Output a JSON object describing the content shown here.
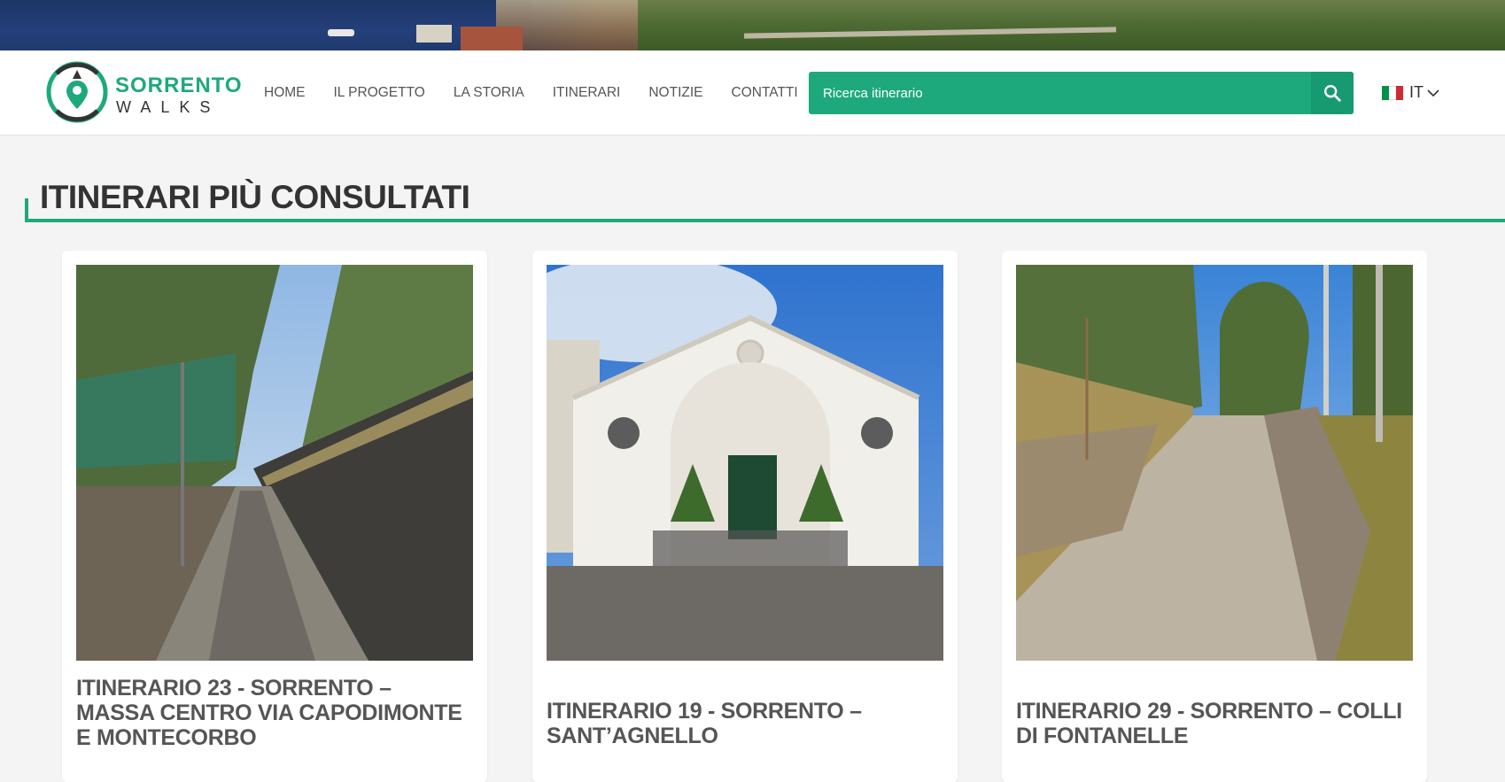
{
  "header": {
    "logo": {
      "word1": "SORRENTO",
      "word2": "WALKS",
      "icon": "compass-pin-icon"
    },
    "nav": [
      {
        "label": "HOME"
      },
      {
        "label": "IL PROGETTO"
      },
      {
        "label": "LA STORIA"
      },
      {
        "label": "ITINERARI"
      },
      {
        "label": "NOTIZIE"
      },
      {
        "label": "CONTATTI"
      }
    ],
    "search": {
      "placeholder": "Ricerca itinerario",
      "icon": "search-icon"
    },
    "language": {
      "code": "IT",
      "icon": "chevron-down-icon",
      "flag_colors": [
        "#009246",
        "#ffffff",
        "#ce2b37"
      ]
    }
  },
  "section": {
    "title": "ITINERARI PIÙ CONSULTATI"
  },
  "cards": [
    {
      "title": "ITINERARIO 23 - SORRENTO – MASSA CENTRO VIA CAPODIMONTE E MONTECORBO"
    },
    {
      "title": "ITINERARIO 19 - SORRENTO – SANT’AGNELLO"
    },
    {
      "title": "ITINERARIO 29 - SORRENTO – COLLI DI FONTANELLE"
    }
  ],
  "colors": {
    "accent": "#1ea97c",
    "accent_dark": "#189a70",
    "text": "#333333"
  }
}
